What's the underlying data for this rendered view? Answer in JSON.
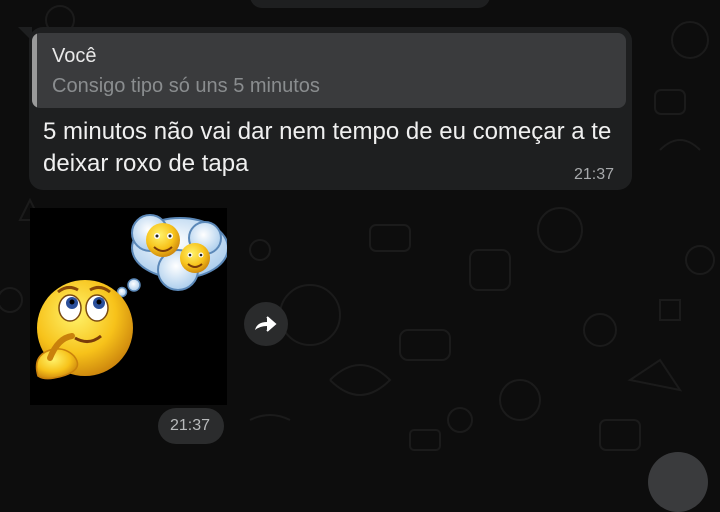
{
  "quote": {
    "author": "Você",
    "text": "Consigo tipo só uns 5 minutos"
  },
  "message": {
    "text": "5 minutos não vai dar nem tempo de eu começar a te deixar roxo de tapa",
    "time": "21:37"
  },
  "sticker": {
    "time": "21:37",
    "description_icon": "thinking-emoji-sticker"
  },
  "colors": {
    "background": "#0d0d0d",
    "bubble": "#1e1f20",
    "quote_bg": "#3a3b3d",
    "text": "#f0f0f0",
    "muted": "#a7a9ab"
  }
}
